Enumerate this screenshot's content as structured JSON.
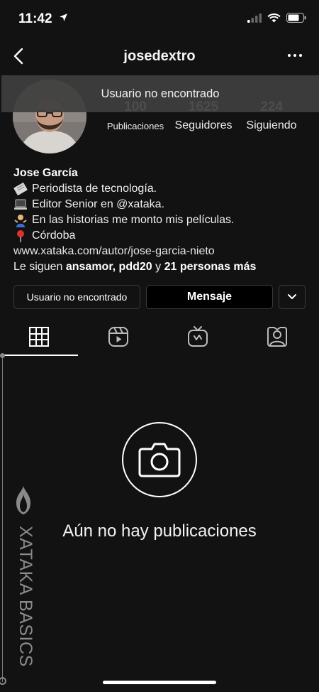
{
  "status_bar": {
    "time": "11:42"
  },
  "header": {
    "username": "josedextro"
  },
  "toast": {
    "message": "Usuario no encontrado"
  },
  "profile": {
    "stats": [
      {
        "value": "100",
        "label": "Publicaciones"
      },
      {
        "value": "1625",
        "label": "Seguidores"
      },
      {
        "value": "224",
        "label": "Siguiendo"
      }
    ],
    "name": "Jose García",
    "bio_lines": [
      "Periodista de tecnología.",
      "Editor Senior en @xataka.",
      "En las historias me monto mis películas.",
      "Córdoba"
    ],
    "website": "www.xataka.com/autor/jose-garcia-nieto",
    "followed_by_prefix": "Le siguen",
    "followed_by_names": "ansamor, pdd20",
    "followed_by_join": "y",
    "followed_by_more": "21 personas más"
  },
  "buttons": {
    "follow": "Usuario no encontrado",
    "message": "Mensaje"
  },
  "tabs": [
    {
      "icon": "grid-icon",
      "active": true
    },
    {
      "icon": "reels-icon",
      "active": false
    },
    {
      "icon": "igtv-icon",
      "active": false
    },
    {
      "icon": "tagged-icon",
      "active": false
    }
  ],
  "empty_state": {
    "icon": "camera-icon",
    "message": "Aún no hay publicaciones"
  },
  "watermark": {
    "text": "XATAKA BASICS"
  },
  "colors": {
    "background": "#121212",
    "text": "#f5f5f5",
    "toast": "#3e3e3e",
    "border": "#3a3a3a"
  }
}
